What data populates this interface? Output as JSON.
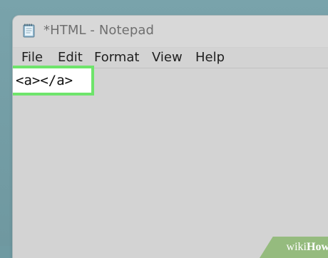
{
  "window": {
    "title": "*HTML - Notepad"
  },
  "menu": {
    "items": [
      {
        "label": "File"
      },
      {
        "label": "Edit"
      },
      {
        "label": "Format"
      },
      {
        "label": "View"
      },
      {
        "label": "Help"
      }
    ]
  },
  "editor": {
    "text": "<a></a>"
  },
  "branding": {
    "wiki": "wiki",
    "how": "How"
  },
  "colors": {
    "desktop": "#6f9aa2",
    "window": "#d3d3d3",
    "highlight_border": "#6ee46b",
    "logo_bg": "#95bb7e"
  },
  "icons": {
    "app": "notepad-icon"
  }
}
